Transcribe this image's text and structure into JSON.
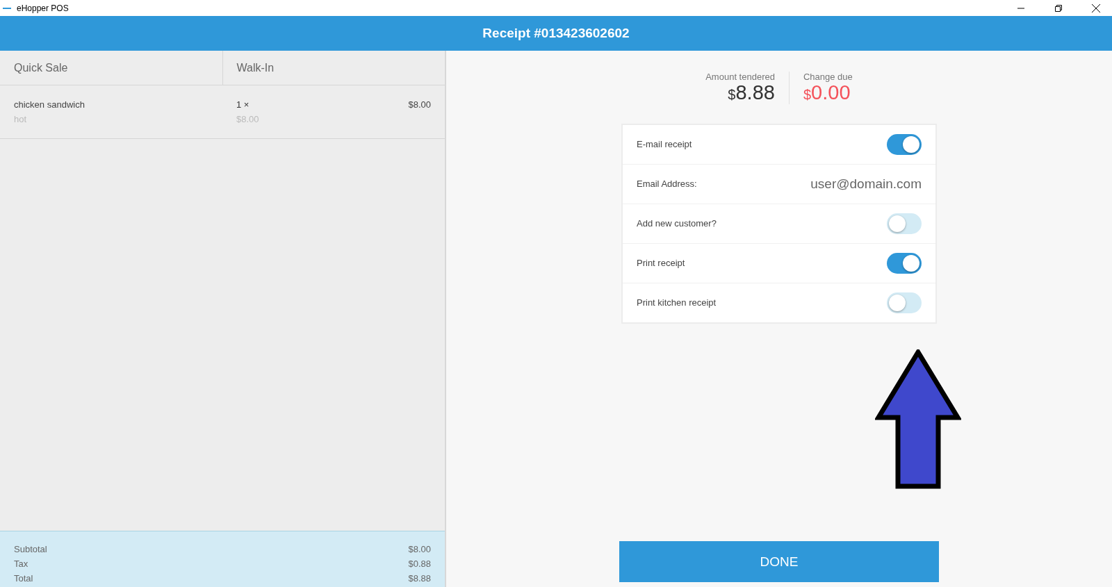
{
  "window": {
    "title": "eHopper POS"
  },
  "header": {
    "title": "Receipt #013423602602"
  },
  "order": {
    "columns": [
      "Quick Sale",
      "Walk-In"
    ],
    "items": [
      {
        "name": "chicken sandwich",
        "modifier": "hot",
        "quantity": "1 ×",
        "unit_price": "$8.00",
        "price": "$8.00"
      }
    ],
    "summary": [
      {
        "label": "Subtotal",
        "value": "$8.00"
      },
      {
        "label": "Tax",
        "value": "$0.88"
      },
      {
        "label": "Total",
        "value": "$8.88"
      }
    ]
  },
  "amounts": [
    {
      "label": "Amount tendered",
      "currency": "$",
      "value": "8.88",
      "kind": "normal"
    },
    {
      "label": "Change due",
      "currency": "$",
      "value": "0.00",
      "kind": "alert"
    }
  ],
  "options": [
    {
      "kind": "toggle",
      "label": "E-mail receipt",
      "on": true
    },
    {
      "kind": "value",
      "label": "Email Address:",
      "value": "user@domain.com"
    },
    {
      "kind": "toggle",
      "label": "Add new customer?",
      "on": false
    },
    {
      "kind": "toggle",
      "label": "Print receipt",
      "on": true
    },
    {
      "kind": "toggle",
      "label": "Print kitchen receipt",
      "on": false
    }
  ],
  "done_button": "DONE"
}
